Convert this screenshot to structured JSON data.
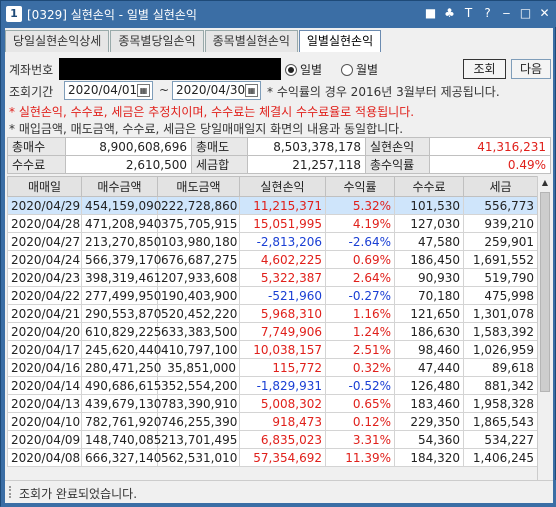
{
  "window": {
    "number": "1",
    "title": "[0329] 실현손익 - 일별 실현손익",
    "icons": [
      "■",
      "♣",
      "T",
      "?",
      "‒",
      "□",
      "✕"
    ]
  },
  "tabs": [
    "당일실현손익상세",
    "종목별당일손익",
    "종목별실현손익",
    "일별실현손익"
  ],
  "query": {
    "account_label": "계좌번호",
    "radio_daily": "일별",
    "radio_monthly": "월별",
    "btn_search": "조회",
    "btn_next": "다음",
    "period_label": "조회기간",
    "date_from": "2020/04/01",
    "tilde": "~",
    "date_to": "2020/04/30",
    "period_note": "* 수익률의 경우 2016년 3월부터 제공됩니다."
  },
  "notes": {
    "red": "* 실현손익, 수수료, 세금은 추정치이며, 수수료는 체결시 수수료율로 적용됩니다.",
    "black": "* 매입금액, 매도금액, 수수료, 세금은 당일매매일지 화면의 내용과 동일합니다."
  },
  "summary": {
    "buy_total_label": "총매수",
    "buy_total": "8,900,608,696",
    "sell_total_label": "총매도",
    "sell_total": "8,503,378,178",
    "pnl_label": "실현손익",
    "pnl": "41,316,231",
    "fee_label": "수수료",
    "fee": "2,610,500",
    "tax_label": "세금합",
    "tax": "21,257,118",
    "ret_label": "총수익률",
    "ret": "0.49%",
    "colors": {
      "positive": "#e0201b",
      "negative": "#1a3fd4"
    }
  },
  "table": {
    "headers": [
      "매매일",
      "매수금액",
      "매도금액",
      "실현손익",
      "수익률",
      "수수료",
      "세금"
    ],
    "rows": [
      [
        "2020/04/29",
        "454,159,090",
        "222,728,860",
        "11,215,371",
        "5.32%",
        "101,530",
        "556,773"
      ],
      [
        "2020/04/28",
        "471,208,940",
        "375,705,915",
        "15,051,995",
        "4.19%",
        "127,030",
        "939,210"
      ],
      [
        "2020/04/27",
        "213,270,850",
        "103,980,180",
        "-2,813,206",
        "-2.64%",
        "47,580",
        "259,901"
      ],
      [
        "2020/04/24",
        "566,379,170",
        "676,687,275",
        "4,602,225",
        "0.69%",
        "186,450",
        "1,691,552"
      ],
      [
        "2020/04/23",
        "398,319,461",
        "207,933,608",
        "5,322,387",
        "2.64%",
        "90,930",
        "519,790"
      ],
      [
        "2020/04/22",
        "277,499,950",
        "190,403,900",
        "-521,960",
        "-0.27%",
        "70,180",
        "475,998"
      ],
      [
        "2020/04/21",
        "290,553,870",
        "520,452,220",
        "5,968,310",
        "1.16%",
        "121,650",
        "1,301,078"
      ],
      [
        "2020/04/20",
        "610,829,225",
        "633,383,500",
        "7,749,906",
        "1.24%",
        "186,630",
        "1,583,392"
      ],
      [
        "2020/04/17",
        "245,620,440",
        "410,797,100",
        "10,038,157",
        "2.51%",
        "98,460",
        "1,026,959"
      ],
      [
        "2020/04/16",
        "280,471,250",
        "35,851,000",
        "115,772",
        "0.32%",
        "47,440",
        "89,618"
      ],
      [
        "2020/04/14",
        "490,686,615",
        "352,554,200",
        "-1,829,931",
        "-0.52%",
        "126,480",
        "881,342"
      ],
      [
        "2020/04/13",
        "439,679,130",
        "783,390,910",
        "5,008,302",
        "0.65%",
        "183,460",
        "1,958,328"
      ],
      [
        "2020/04/10",
        "782,761,920",
        "746,255,390",
        "918,473",
        "0.12%",
        "229,350",
        "1,865,543"
      ],
      [
        "2020/04/09",
        "148,740,085",
        "213,701,495",
        "6,835,023",
        "3.31%",
        "54,360",
        "534,227"
      ],
      [
        "2020/04/08",
        "666,327,140",
        "562,531,010",
        "57,354,692",
        "11.39%",
        "184,320",
        "1,406,245"
      ]
    ],
    "row_signs": [
      "pos",
      "pos",
      "neg",
      "pos",
      "pos",
      "neg",
      "pos",
      "pos",
      "pos",
      "pos",
      "neg",
      "pos",
      "pos",
      "pos",
      "pos"
    ]
  },
  "status": {
    "message": "조회가 완료되었습니다."
  }
}
